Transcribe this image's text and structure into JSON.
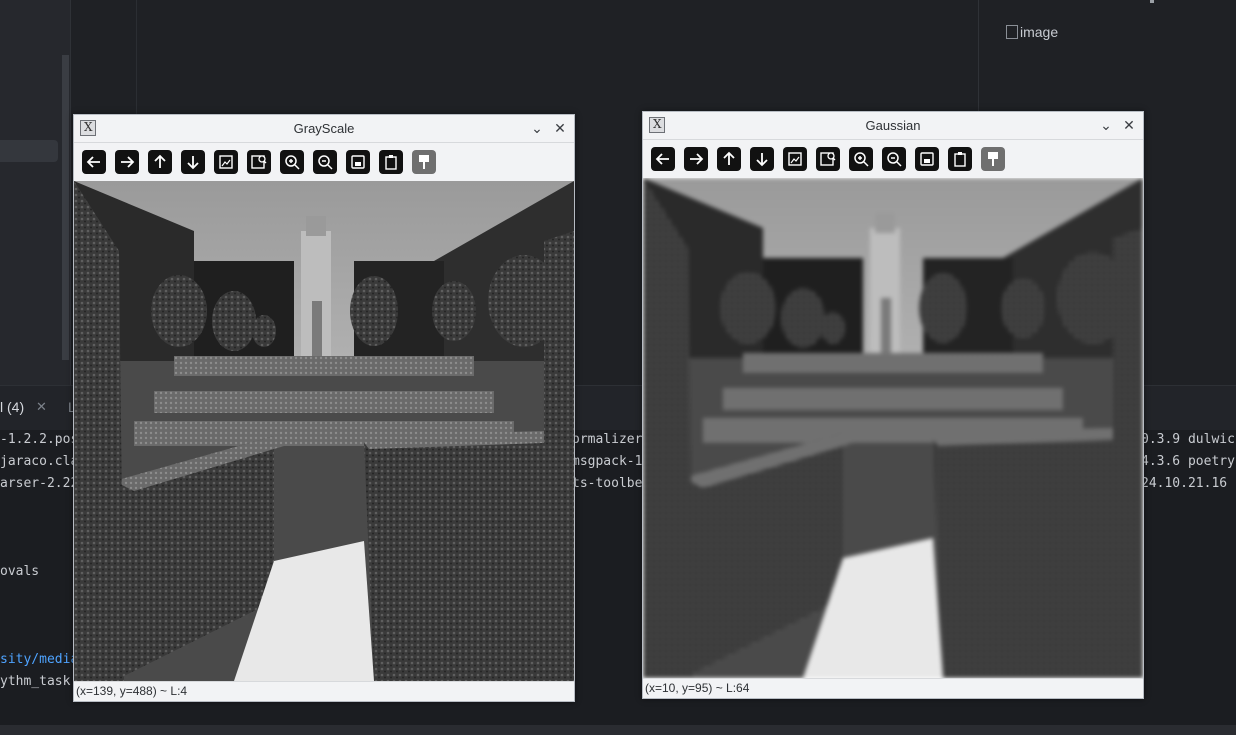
{
  "terminal": {
    "tab_label": "l (4)",
    "tab2_label": "L",
    "lines_left": [
      "-1.2.2.pos",
      "jaraco.cla",
      "arser-2.22",
      "ovals",
      "sity/media",
      "ythm_task"
    ],
    "lines_mid": [
      "ormalizer",
      "msgpack-1",
      "ts-toolbe"
    ],
    "lines_right": [
      "0.3.9 dulwic",
      "4.3.6 poetry",
      "24.10.21.16"
    ]
  },
  "ide": {
    "broken_image_alt": "image"
  },
  "windows": {
    "grayscale": {
      "title": "GrayScale",
      "status": "(x=139, y=488) ~ L:4"
    },
    "gaussian": {
      "title": "Gaussian",
      "status": "(x=10, y=95) ~ L:64"
    }
  },
  "toolbar_icons": [
    "arrow-left-icon",
    "arrow-right-icon",
    "arrow-up-icon",
    "arrow-down-icon",
    "image-icon",
    "zoom-image-icon",
    "zoom-in-icon",
    "zoom-out-icon",
    "save-icon",
    "clipboard-icon",
    "brush-icon"
  ],
  "colors": {
    "ide_bg": "#1f2125",
    "link": "#4ea3ff",
    "window_chrome": "#f2f3f5",
    "tool_button": "#111111"
  }
}
